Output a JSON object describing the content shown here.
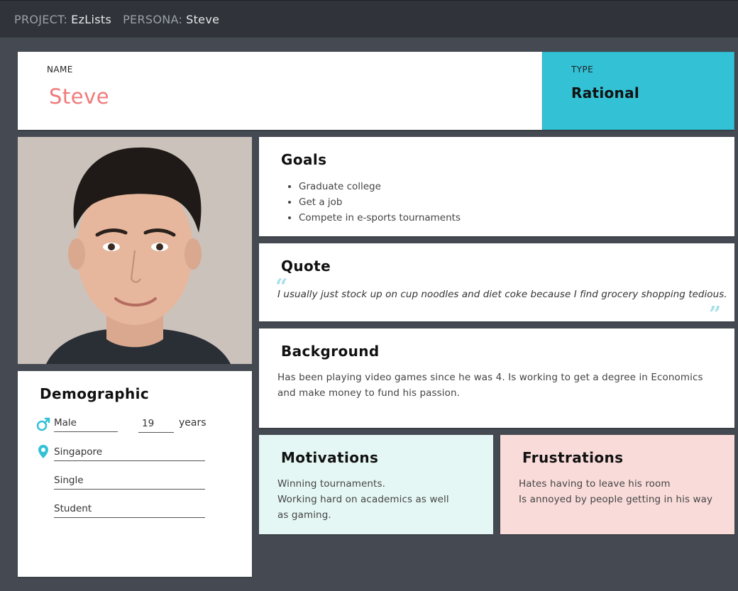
{
  "header": {
    "project_key": "PROJECT:",
    "project_value": "EzLists",
    "persona_key": "PERSONA:",
    "persona_value": "Steve"
  },
  "name_card": {
    "label": "NAME",
    "value": "Steve"
  },
  "type_card": {
    "label": "TYPE",
    "value": "Rational"
  },
  "goals": {
    "title": "Goals",
    "items": [
      "Graduate college",
      "Get a job",
      "Compete in e-sports tournaments"
    ]
  },
  "quote": {
    "title": "Quote",
    "text": "I usually just stock up on cup noodles and diet coke because I find grocery shopping tedious."
  },
  "background": {
    "title": "Background",
    "text": "Has been playing video games since he was 4. Is working to get a degree in Economics and make money to fund his passion."
  },
  "motivations": {
    "title": "Motivations",
    "lines": [
      "Winning tournaments.",
      "Working hard on academics as well as gaming."
    ]
  },
  "frustrations": {
    "title": "Frustrations",
    "lines": [
      "Hates having to leave his room",
      "Is annoyed by people getting in his way"
    ]
  },
  "demographic": {
    "title": "Demographic",
    "gender": "Male",
    "age": "19",
    "age_unit": "years",
    "location": "Singapore",
    "status": "Single",
    "occupation": "Student"
  },
  "colors": {
    "accent_teal": "#33c1d6",
    "name_coral": "#f07a7a",
    "motivations_bg": "#e4f7f4",
    "frustrations_bg": "#f9dcda"
  }
}
